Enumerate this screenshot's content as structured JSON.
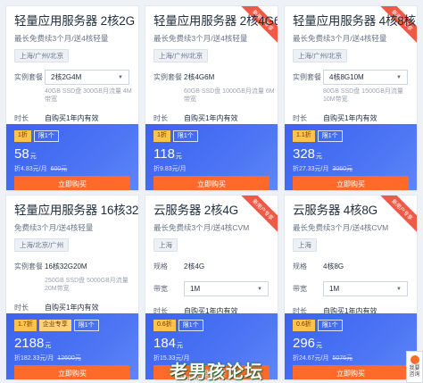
{
  "cards": [
    {
      "title": "轻量应用服务器 2核2G",
      "subtitle": "最长免费续3个月/送4核轻量",
      "region": "上海/广州/北京",
      "row1_label": "实例套餐",
      "row1_value": "2核2G4M",
      "row1_is_select": true,
      "note": "40GB SSD盘 300GB月流量 4M带宽",
      "duration_label": "时长",
      "duration_value": "自购买1年内有效",
      "tag1": "1折",
      "tag2": "限1个",
      "price": "58",
      "price_unit": "元",
      "monthly": "折4.83元/月",
      "original": "600元",
      "buy_label": "立即购买",
      "badge": ""
    },
    {
      "title": "轻量应用服务器 2核4G6M",
      "subtitle": "最长免费续3个月/送4核轻量",
      "region": "上海/广州/北京",
      "row1_label": "实例套餐",
      "row1_value": "2核4G6M",
      "row1_is_select": false,
      "note": "60GB SSD盘 1000GB月流量 6M带宽",
      "duration_label": "时长",
      "duration_value": "自购买1年内有效",
      "tag1": "1折",
      "tag2": "限1个",
      "price": "118",
      "price_unit": "元",
      "monthly": "折9.83元/月",
      "original": "",
      "buy_label": "立即购买",
      "badge": "新用户专享"
    },
    {
      "title": "轻量应用服务器 4核8核",
      "subtitle": "最长免费续3个月/送4核轻量",
      "region": "上海/广州/北京",
      "row1_label": "实例套餐",
      "row1_value": "4核8G10M",
      "row1_is_select": true,
      "note": "80GB SSD盘 1500GB月流量 10M带宽",
      "duration_label": "时长",
      "duration_value": "自购买1年内有效",
      "tag1": "1.1折",
      "tag2": "限1个",
      "price": "328",
      "price_unit": "元",
      "monthly": "折27.33元/月",
      "original": "3060元",
      "buy_label": "立即购买",
      "badge": "新用户专享"
    },
    {
      "title": "轻量应用服务器 16核32G",
      "subtitle": "免费续3个月/送4核轻量",
      "region": "上海/北京/广州",
      "row1_label": "实例套餐",
      "row1_value": "16核32G20M",
      "row1_is_select": false,
      "note": "250GB SSD盘 5000GB月流量 20M带宽",
      "duration_label": "时长",
      "duration_value": "自购买1年内有效",
      "tag1": "1.7折",
      "tag2": "企业专享",
      "tag3": "限1个",
      "price": "2188",
      "price_unit": "元",
      "monthly": "折182.33元/月",
      "original": "12600元",
      "buy_label": "立即购买",
      "badge": ""
    },
    {
      "title": "云服务器 2核4G",
      "subtitle": "最长免费续3个月/送4核CVM",
      "region": "上海",
      "row1_label": "规格",
      "row1_value": "2核4G",
      "row1_is_select": false,
      "row2_label": "带宽",
      "row2_value": "1M",
      "duration_label": "时长",
      "duration_value": "自购买1年内有效",
      "tag1": "0.6折",
      "tag2": "限1个",
      "price": "184",
      "price_unit": "元",
      "monthly": "折15.33元/月",
      "original": "",
      "buy_label": "立即购买",
      "badge": "新用户专享"
    },
    {
      "title": "云服务器 4核8G",
      "subtitle": "最长免费续3个月/送4核CVM",
      "region": "上海",
      "row1_label": "规格",
      "row1_value": "4核8G",
      "row1_is_select": false,
      "row2_label": "带宽",
      "row2_value": "1M",
      "duration_label": "时长",
      "duration_value": "自购买1年内有效",
      "tag1": "0.6折",
      "tag2": "限1个",
      "price": "296",
      "price_unit": "元",
      "monthly": "折24.67元/月",
      "original": "5076元",
      "buy_label": "立即购买",
      "badge": "新用户专享"
    }
  ],
  "watermark": "老男孩论坛",
  "watermark_sub": "LSPW.NET",
  "corner_label": "我要咨询",
  "colors": {
    "blue": "#4169f0",
    "orange": "#ff6a2a",
    "badge": "#ee5a45"
  }
}
